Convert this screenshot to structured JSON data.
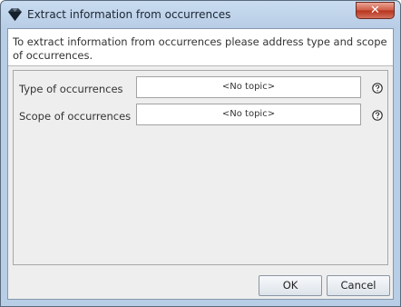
{
  "window": {
    "title": "Extract information from occurrences",
    "close_symbol": "✕",
    "icon": "app-gem-icon"
  },
  "instructions": {
    "text": "To extract information from occurrences please address type and scope of occurrences."
  },
  "form": {
    "rows": [
      {
        "label": "Type of occurrences",
        "value": "<No topic>",
        "help_icon": "help-icon"
      },
      {
        "label": "Scope of occurrences",
        "value": "<No topic>",
        "help_icon": "help-icon"
      }
    ]
  },
  "buttons": {
    "ok": "OK",
    "cancel": "Cancel"
  },
  "colors": {
    "title_bar": "#c9dcf0",
    "client_bg": "#eeeeee",
    "close_button": "#cf5a43"
  }
}
